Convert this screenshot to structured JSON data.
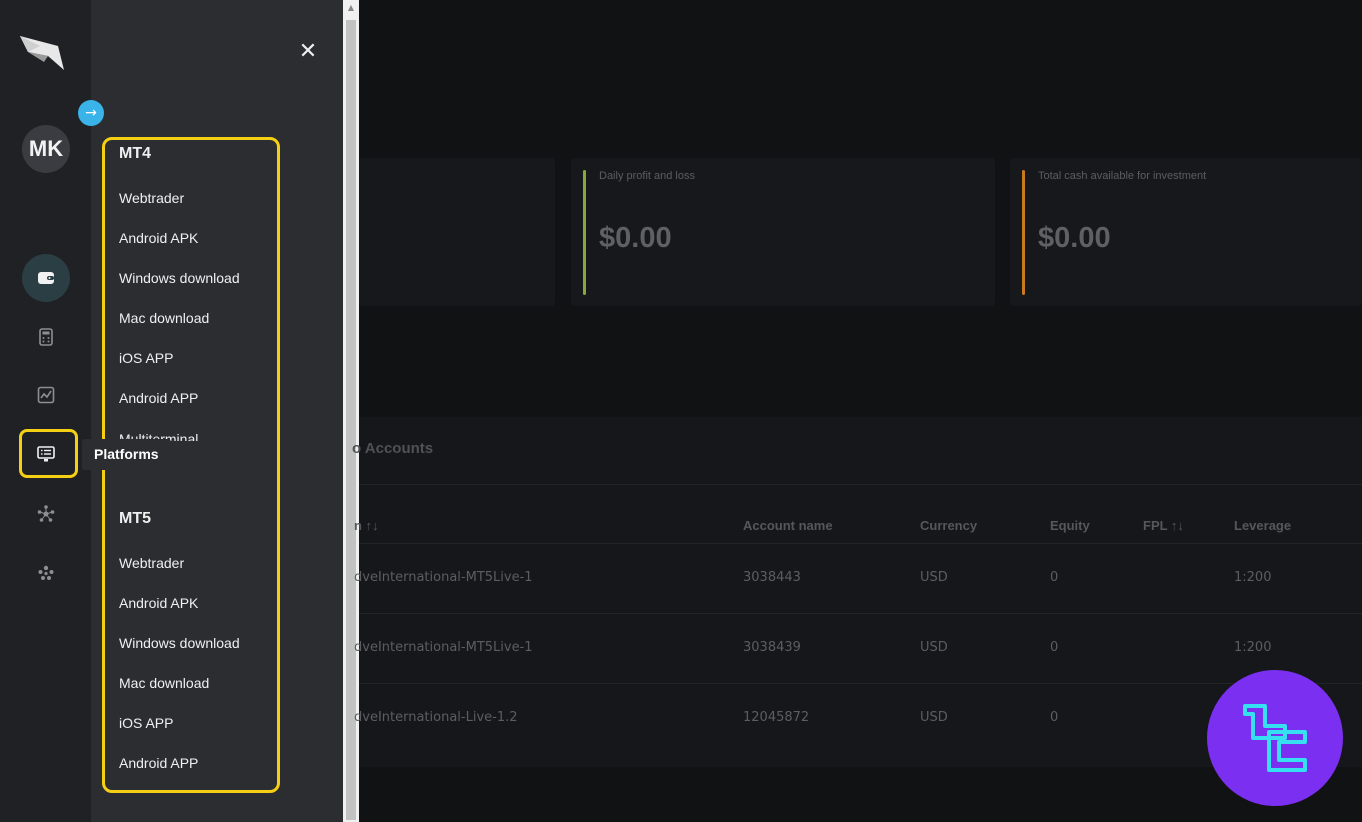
{
  "user": {
    "initials": "MK"
  },
  "rail": {
    "tooltip": "Platforms",
    "icons": [
      "wallet-icon",
      "calculator-icon",
      "chart-icon",
      "platforms-icon",
      "network-icon",
      "community-icon"
    ]
  },
  "platforms_menu": {
    "mt4": {
      "title": "MT4",
      "items": [
        "Webtrader",
        "Android APK",
        "Windows download",
        "Mac download",
        "iOS APP",
        "Android APP",
        "Multiterminal"
      ]
    },
    "mt5": {
      "title": "MT5",
      "items": [
        "Webtrader",
        "Android APK",
        "Windows download",
        "Mac download",
        "iOS APP",
        "Android APP"
      ]
    }
  },
  "cards": [
    {
      "label": "Daily profit and loss",
      "value": "$0.00",
      "accent": "#8aa83a"
    },
    {
      "label": "Total cash available for investment",
      "value": "$0.00",
      "accent": "#c87a1e"
    }
  ],
  "accounts": {
    "title_fragment": "o Accounts",
    "columns": [
      "n ↑↓",
      "Account name",
      "Currency",
      "Equity",
      "FPL ↑↓",
      "Leverage"
    ],
    "rows": [
      {
        "server": "dveInternational-MT5Live-1",
        "account": "3038443",
        "currency": "USD",
        "equity": "0",
        "leverage": "1:200"
      },
      {
        "server": "dveInternational-MT5Live-1",
        "account": "3038439",
        "currency": "USD",
        "equity": "0",
        "leverage": "1:200"
      },
      {
        "server": "dveInternational-Live-1.2",
        "account": "12045872",
        "currency": "USD",
        "equity": "0",
        "leverage": ""
      }
    ]
  },
  "colors": {
    "highlight": "#f5cf14",
    "expand": "#3ab4e8",
    "badge": "#7b2ff0",
    "badge_logo": "#36e0f0"
  }
}
